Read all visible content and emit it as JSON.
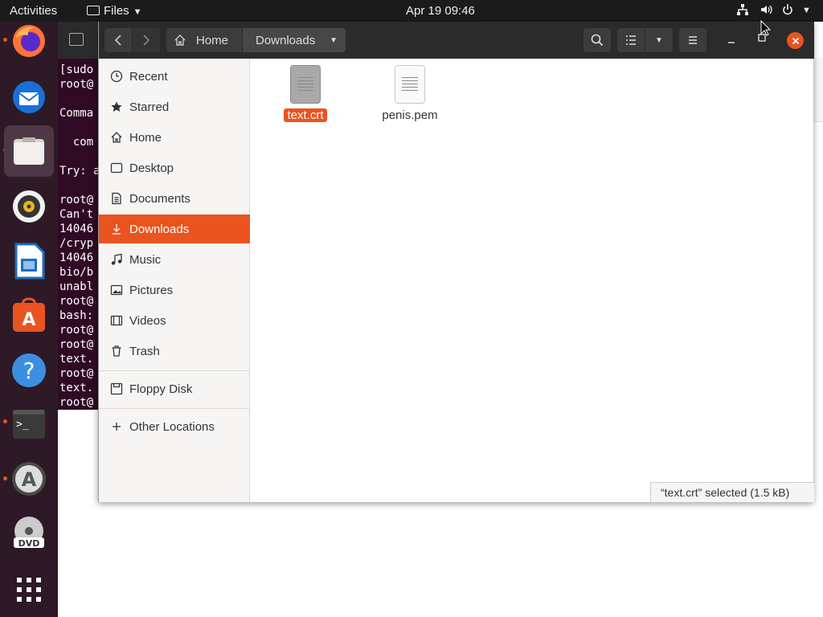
{
  "topbar": {
    "activities": "Activities",
    "app_name": "Files",
    "clock": "Apr 19  09:46"
  },
  "dock": {
    "apps": [
      "firefox-icon",
      "thunderbird-icon",
      "files-icon",
      "rhythmbox-icon",
      "libreoffice-writer-icon",
      "ubuntu-software-icon",
      "help-icon",
      "terminal-icon",
      "software-updater-icon",
      "dvd-icon",
      "show-applications-icon"
    ]
  },
  "terminal": {
    "lines": [
      "[sudo",
      "root@",
      "",
      "Comma",
      "",
      "  com",
      "",
      "Try: a",
      "",
      "root@",
      "Can't",
      "14046",
      "/cryp",
      "14046",
      "bio/b",
      "unabl",
      "root@",
      "bash:",
      "root@",
      "root@",
      "text.",
      "root@",
      "text.",
      "root@"
    ]
  },
  "headerbar": {
    "path": [
      "Home",
      "Downloads"
    ]
  },
  "sidebar": {
    "items": [
      {
        "label": "Recent",
        "icon": "clock-icon"
      },
      {
        "label": "Starred",
        "icon": "star-icon"
      },
      {
        "label": "Home",
        "icon": "home-icon"
      },
      {
        "label": "Desktop",
        "icon": "desktop-icon"
      },
      {
        "label": "Documents",
        "icon": "document-icon"
      },
      {
        "label": "Downloads",
        "icon": "download-icon"
      },
      {
        "label": "Music",
        "icon": "music-icon"
      },
      {
        "label": "Pictures",
        "icon": "picture-icon"
      },
      {
        "label": "Videos",
        "icon": "video-icon"
      },
      {
        "label": "Trash",
        "icon": "trash-icon"
      },
      {
        "label": "Floppy Disk",
        "icon": "floppy-icon"
      },
      {
        "label": "Other Locations",
        "icon": "plus-icon"
      }
    ]
  },
  "files": [
    {
      "name": "text.crt"
    },
    {
      "name": "penis.pem"
    }
  ],
  "status": {
    "text": "“text.crt” selected  (1.5 kB)"
  },
  "colors": {
    "accent": "#e95420",
    "dock": "#2d1a26",
    "terminal": "#300a24",
    "topbar": "#1b1b1b"
  }
}
